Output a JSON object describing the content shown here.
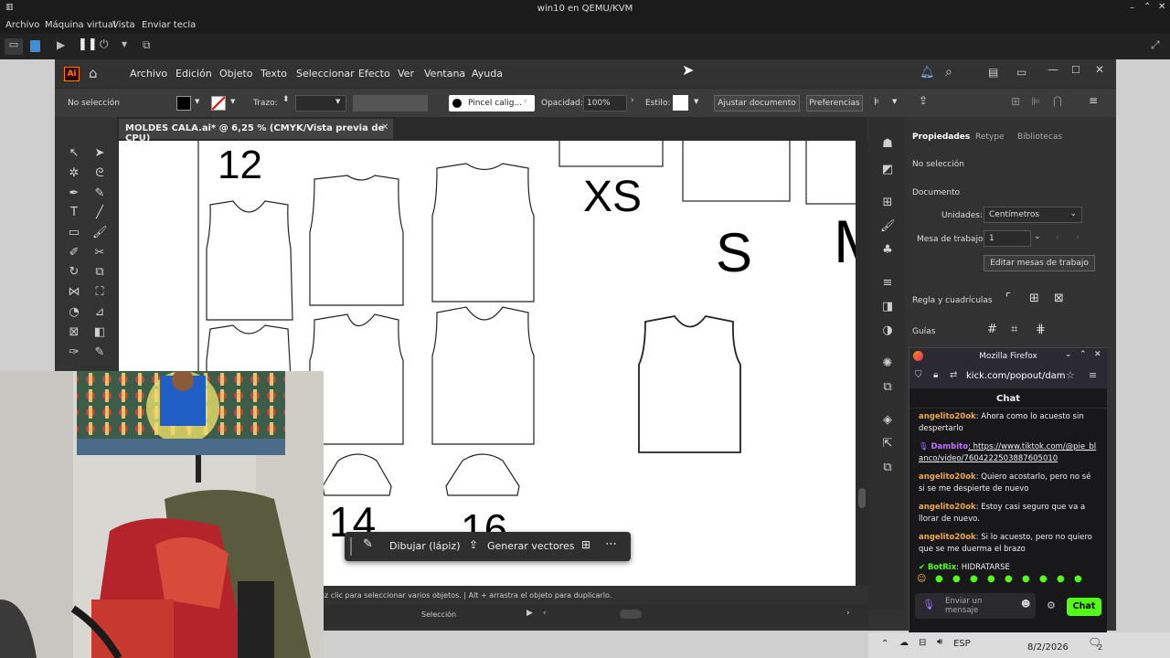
{
  "host": {
    "window_title": "win10 en QEMU/KVM",
    "menu": [
      "Archivo",
      "Máquina virtual",
      "Vista",
      "Enviar tecla"
    ]
  },
  "illustrator": {
    "logo": "Ai",
    "menu": [
      "Archivo",
      "Edición",
      "Objeto",
      "Texto",
      "Seleccionar",
      "Efecto",
      "Ver",
      "Ventana",
      "Ayuda"
    ],
    "control": {
      "selection": "No selección",
      "stroke_label": "Trazo:",
      "brush": "Pincel calig...",
      "opacity_label": "Opacidad:",
      "opacity_value": "100%",
      "style_label": "Estilo:",
      "fit_button": "Ajustar documento",
      "prefs_button": "Preferencias"
    },
    "document_tab": "MOLDES CALA.ai* @ 6,25 % (CMYK/Vista previa de CPU)",
    "canvas_labels": [
      "12",
      "XS",
      "S",
      "M",
      "14",
      "16"
    ],
    "status_hint": "ús + haz clic para seleccionar varios objetos.  |  Alt + arrastra el objeto para duplicarlo.",
    "status_mode": "Selección",
    "pencil_bar": {
      "draw": "Dibujar (lápiz)",
      "vectorize": "Generar vectores"
    },
    "properties": {
      "tabs": [
        "Propiedades",
        "Retype",
        "Bibliotecas"
      ],
      "no_selection": "No selección",
      "document_section": "Documento",
      "units_label": "Unidades:",
      "units_value": "Centímetros",
      "artboard_label": "Mesa de trabajo:",
      "artboard_value": "1",
      "edit_artboards": "Editar mesas de trabajo",
      "rulers_label": "Regla y cuadrículas",
      "guides_label": "Guías"
    }
  },
  "firefox": {
    "title": "Mozilla Firefox",
    "url": "kick.com/popout/dambi",
    "chat_header": "Chat",
    "messages": [
      {
        "user": "angelito20ok",
        "color": "#f0a848",
        "text": ": Ahora como lo acuesto sin despertarlo"
      },
      {
        "user": "Dambito",
        "color": "#c070ff",
        "text": ": https://www.tiktok.com/@pie_blanco/video/7604222503887605010",
        "link": true
      },
      {
        "user": "angelito20ok",
        "color": "#f0a848",
        "text": ": Quiero acostarlo, pero no sé si se me despierte de nuevo"
      },
      {
        "user": "angelito20ok",
        "color": "#f0a848",
        "text": ": Estoy casi seguro que va a llorar de nuevo."
      },
      {
        "user": "angelito20ok",
        "color": "#f0a848",
        "text": ": Si lo acuesto, pero no quiero que se me duerma el brazo"
      },
      {
        "user": "BotRix",
        "color": "#53fc18",
        "text": ": HIDRATARSE"
      }
    ],
    "input_placeholder": "Enviar un mensaje",
    "send_button": "Chat"
  },
  "taskbar": {
    "lang": "ESP",
    "date": "8/2/2026",
    "notif_count": "2"
  },
  "colors": {
    "kick_green": "#53fc18",
    "ai_orange": "#ff7c00",
    "ai_bg": "#323232"
  }
}
